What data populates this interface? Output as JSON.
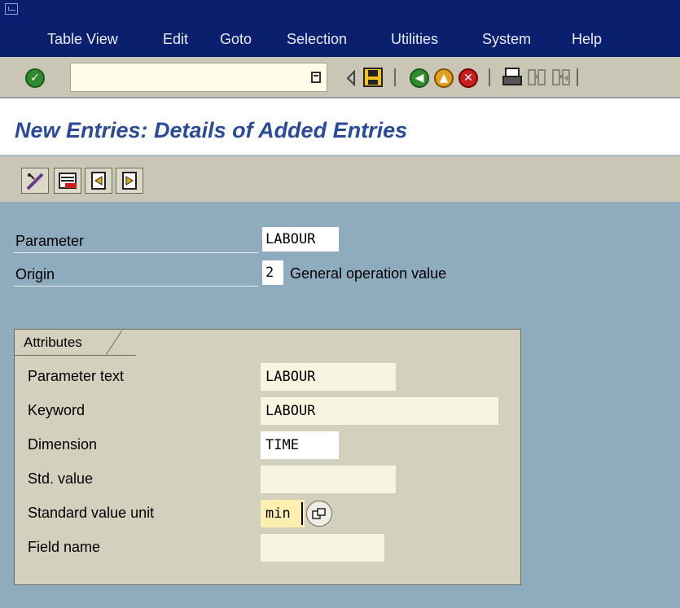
{
  "menu": {
    "items": [
      {
        "label": "Table View"
      },
      {
        "label": "Edit"
      },
      {
        "label": "Goto"
      },
      {
        "label": "Selection"
      },
      {
        "label": "Utilities"
      },
      {
        "label": "System"
      },
      {
        "label": "Help"
      }
    ]
  },
  "toolbar": {
    "command_field": "",
    "icons": [
      "enter-icon",
      "dropdown-icon",
      "back-arrow-icon",
      "save-icon",
      "back-icon",
      "exit-icon",
      "cancel-icon",
      "print-icon",
      "find-icon",
      "find-next-icon"
    ]
  },
  "page": {
    "title": "New Entries: Details of Added Entries"
  },
  "app_toolbar": {
    "icons": [
      "change-icon",
      "delete-icon",
      "previous-entry-icon",
      "next-entry-icon"
    ]
  },
  "header_fields": {
    "parameter": {
      "label": "Parameter",
      "value": "LABOUR"
    },
    "origin": {
      "label": "Origin",
      "value": "2",
      "description": "General operation value"
    }
  },
  "attributes": {
    "tab_label": "Attributes",
    "parameter_text": {
      "label": "Parameter text",
      "value": "LABOUR"
    },
    "keyword": {
      "label": "Keyword",
      "value": "LABOUR"
    },
    "dimension": {
      "label": "Dimension",
      "value": "TIME"
    },
    "std_value": {
      "label": "Std. value",
      "value": ""
    },
    "std_value_unit": {
      "label": "Standard value unit",
      "value": "min"
    },
    "field_name": {
      "label": "Field name",
      "value": ""
    }
  },
  "colors": {
    "menubar": "#0a1f6e",
    "toolbar": "#c9c6b6",
    "background": "#8fabbe",
    "title": "#2a4a9a",
    "highlight_field": "#fcefb0"
  }
}
